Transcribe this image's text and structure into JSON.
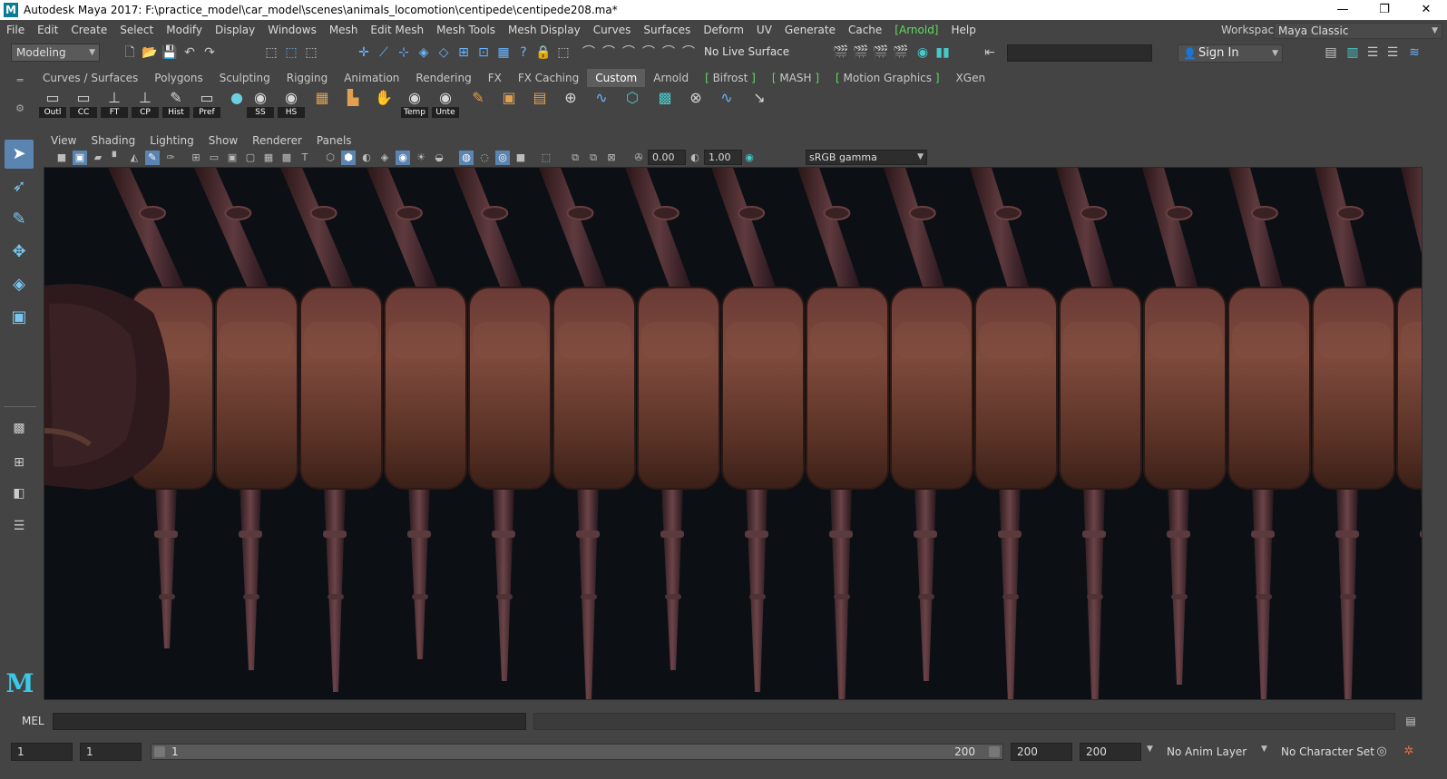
{
  "window": {
    "title": "Autodesk Maya 2017: F:\\practice_model\\car_model\\scenes\\animals_locomotion\\centipede\\centipede208.ma*",
    "minimize": "—",
    "maximize": "❐",
    "close": "✕"
  },
  "menu": {
    "items": [
      "File",
      "Edit",
      "Create",
      "Select",
      "Modify",
      "Display",
      "Windows",
      "Mesh",
      "Edit Mesh",
      "Mesh Tools",
      "Mesh Display",
      "Curves",
      "Surfaces",
      "Deform",
      "UV",
      "Generate",
      "Cache",
      "[Arnold]",
      "Help"
    ],
    "workspace_label": "Workspace :",
    "workspace_value": "Maya Classic"
  },
  "statusline": {
    "mode": "Modeling",
    "live_surface": "No Live Surface",
    "sign_in": "Sign In"
  },
  "shelf": {
    "tabs": [
      "Curves / Surfaces",
      "Polygons",
      "Sculpting",
      "Rigging",
      "Animation",
      "Rendering",
      "FX",
      "FX Caching",
      "Custom",
      "Arnold",
      "Bifrost",
      "MASH",
      "Motion Graphics",
      "XGen"
    ],
    "active_tab": "Custom",
    "buttons": [
      "Outl",
      "CC",
      "FT",
      "CP",
      "Hist",
      "Pref",
      "",
      "SS",
      "HS",
      "",
      "",
      "",
      "Temp",
      "Unte"
    ]
  },
  "panel": {
    "menus": [
      "View",
      "Shading",
      "Lighting",
      "Show",
      "Renderer",
      "Panels"
    ],
    "exposure": "0.00",
    "gamma": "1.00",
    "color_space": "sRGB gamma"
  },
  "commandline": {
    "label": "MEL"
  },
  "range": {
    "start_time": "1",
    "playback_start": "1",
    "slider_start": "1",
    "slider_end": "200",
    "playback_end": "200",
    "end_time": "200",
    "anim_layer": "No Anim Layer",
    "character_set": "No Character Set"
  },
  "colors": {
    "ui_bg": "#444444",
    "viewport_bg": "#0c0f14",
    "accent_green": "#5fdc5f",
    "active_blue": "#5b84b0"
  }
}
